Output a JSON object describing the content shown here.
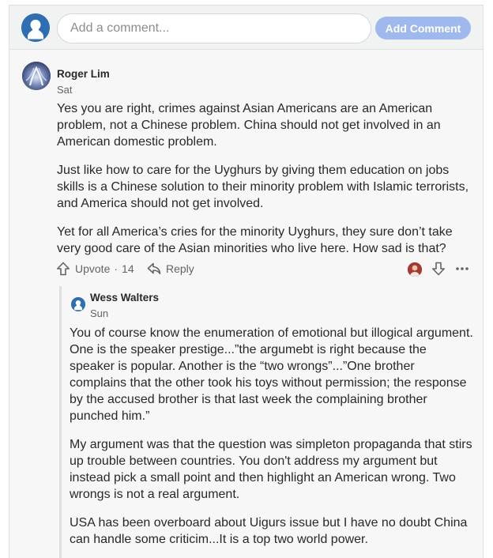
{
  "composer": {
    "placeholder": "Add a comment...",
    "button_label": "Add Comment",
    "button_color": "#9fb9ef"
  },
  "comment": {
    "author": "Roger Lim",
    "time": "Sat",
    "paragraphs": [
      "Yes you are right, crimes against Asian Americans are an American problem, not a Chinese problem. China should not get involved in an American domestic problem.",
      "Just like how to care for the Uyghurs by giving them education on jobs skills is a Chinese solution to their minority problem with Islamic terrorists, and America should not get involved.",
      "Yet for all America’s cries for the minority Uyghurs, they sure don’t take very good care of the Asian minorities who live here. How sad is that?"
    ],
    "actions": {
      "upvote_label": "Upvote",
      "separator": "·",
      "upvote_count": "14",
      "reply_label": "Reply",
      "upvote_icon": "arrow-up-outline-icon",
      "reply_icon": "reply-arrow-icon",
      "downvote_icon": "arrow-down-outline-icon",
      "more_icon": "more-dots-icon"
    }
  },
  "reply": {
    "author": "Wess Walters",
    "time": "Sun",
    "paragraphs": [
      "You of course know the enumeration of emotional but illogical argument. One is the speaker prestige...”the argumebt is right because the speaker is popular. Another is the “two wrongs”...”One brother complains that the other took his toys without permission; the response by the accused brother is that last week the complaining brother punched him.”",
      "My argument was that the question was simpleton propaganda that stirs up trouble between countries. You don't address my argument but instead pick a small point and then highlight an American wrong. Two wrongs is not a real argument.",
      "USA has been overboard about Uigurs issue but I have no doubt China can handle some criticim...It is a top two world power."
    ]
  }
}
